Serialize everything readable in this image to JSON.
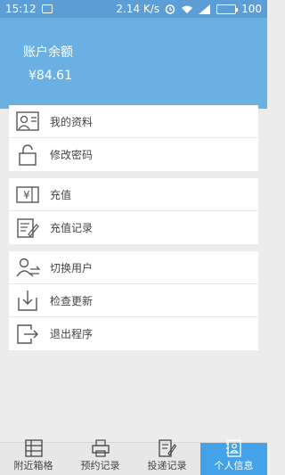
{
  "statusbar": {
    "time": "15:12",
    "speed": "2.14 K/s",
    "battery": "100"
  },
  "account": {
    "label": "账户余额",
    "balance": "¥84.61"
  },
  "menu": {
    "group1": [
      {
        "label": "我的资料",
        "icon": "profile-card-icon"
      },
      {
        "label": "修改密码",
        "icon": "lock-icon"
      }
    ],
    "group2": [
      {
        "label": "充值",
        "icon": "yen-wallet-icon"
      },
      {
        "label": "充值记录",
        "icon": "record-edit-icon"
      }
    ],
    "group3": [
      {
        "label": "切换用户",
        "icon": "switch-user-icon"
      },
      {
        "label": "检查更新",
        "icon": "download-update-icon"
      },
      {
        "label": "退出程序",
        "icon": "exit-icon"
      }
    ]
  },
  "tabs": [
    {
      "label": "附近箱格",
      "icon": "grid-cabinet-icon"
    },
    {
      "label": "预约记录",
      "icon": "print-record-icon"
    },
    {
      "label": "投递记录",
      "icon": "edit-list-icon"
    },
    {
      "label": "个人信息",
      "icon": "contact-book-icon",
      "active": true
    }
  ],
  "colors": {
    "header": "#6ab0e3",
    "statusbar": "#5d9ed6",
    "tab_active": "#43a2e8"
  }
}
